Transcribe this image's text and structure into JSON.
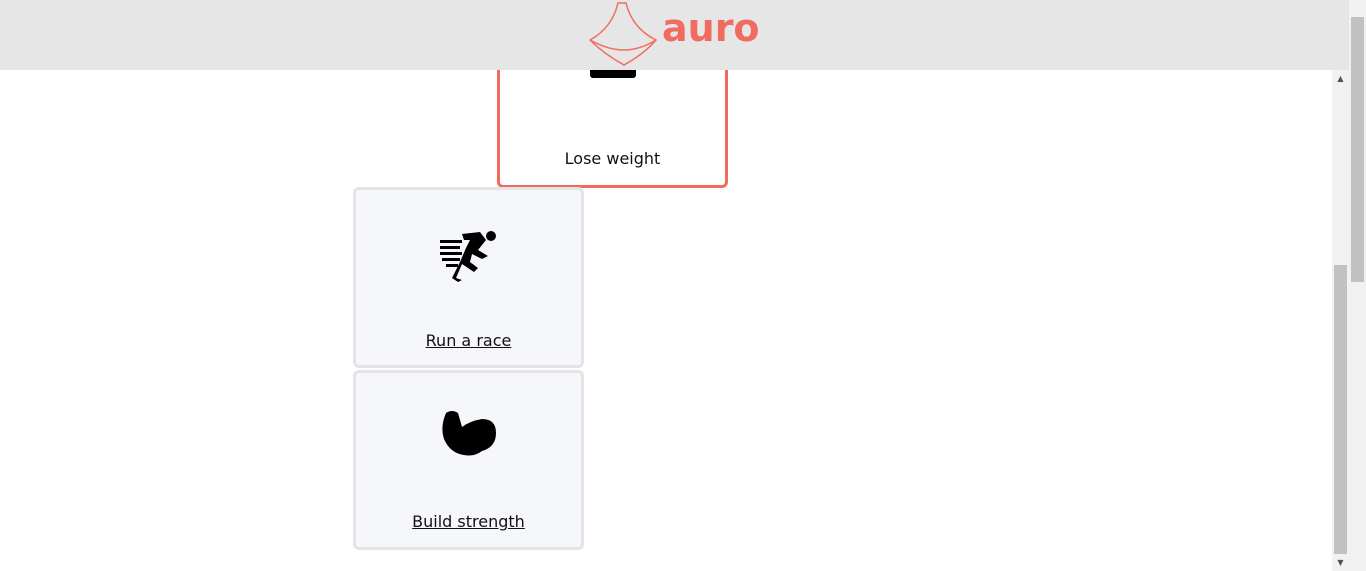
{
  "header": {
    "brand": "auro",
    "brand_color": "#f26b5f"
  },
  "goals": [
    {
      "label": "Lose weight",
      "icon": "scale-icon",
      "selected": true
    },
    {
      "label": "Run a race",
      "icon": "runner-icon",
      "selected": false
    },
    {
      "label": "Build strength",
      "icon": "flexed-bicep-icon",
      "selected": false
    }
  ],
  "scrollbar": {
    "up_arrow": "▲",
    "down_arrow": "▼"
  }
}
